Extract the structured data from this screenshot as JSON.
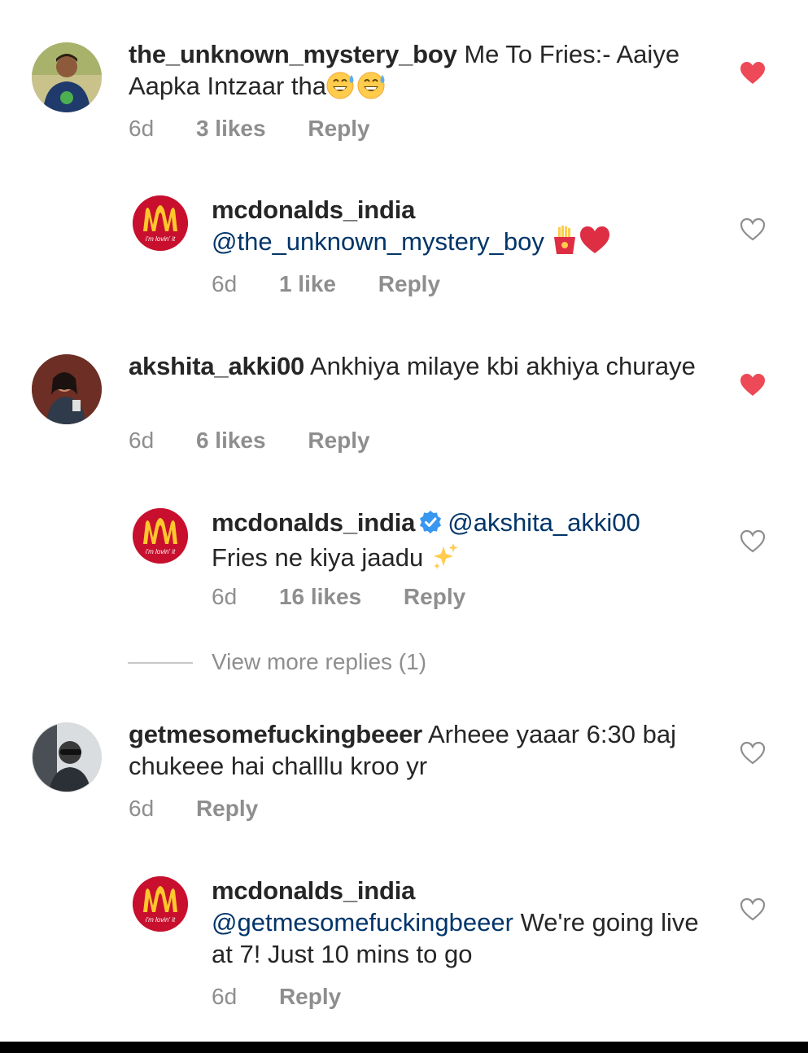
{
  "colors": {
    "liked_heart": "#ed4956",
    "mention": "#003569",
    "meta_text": "#8e8e8e",
    "mcd_red": "#c8102e",
    "mcd_yellow": "#ffc72c",
    "verified_blue": "#3897f0"
  },
  "comments": [
    {
      "username": "the_unknown_mystery_boy",
      "text": "Me To Fries:- Aaiye Aapka Intzaar tha",
      "emojis": [
        "grinning-sweat-emoji",
        "grinning-sweat-emoji"
      ],
      "time": "6d",
      "likes": "3 likes",
      "reply_label": "Reply",
      "liked": true,
      "reply": {
        "username": "mcdonalds_india",
        "mention": "@the_unknown_mystery_boy",
        "text": "",
        "emojis": [
          "fries-emoji",
          "red-heart-emoji"
        ],
        "time": "6d",
        "likes": "1 like",
        "reply_label": "Reply",
        "liked": false,
        "logo_text": "i'm lovin' it"
      }
    },
    {
      "username": "akshita_akki00",
      "text": "Ankhiya milaye kbi akhiya churaye",
      "time": "6d",
      "likes": "6 likes",
      "reply_label": "Reply",
      "liked": true,
      "reply": {
        "username": "mcdonalds_india",
        "verified": true,
        "mention": "@akshita_akki00",
        "text": "Fries ne kiya jaadu",
        "emojis": [
          "sparkles-emoji"
        ],
        "time": "6d",
        "likes": "16 likes",
        "reply_label": "Reply",
        "liked": false,
        "logo_text": "i'm lovin' it"
      },
      "view_more": "View more replies (1)"
    },
    {
      "username": "getmesomefuckingbeeer",
      "text": "Arheee yaaar 6:30 baj chukeee hai challlu kroo yr",
      "time": "6d",
      "reply_label": "Reply",
      "liked": false,
      "reply": {
        "username": "mcdonalds_india",
        "mention": "@getmesomefuckingbeeer",
        "text": "We're going live at 7! Just 10 mins to go",
        "time": "6d",
        "reply_label": "Reply",
        "liked": false,
        "logo_text": "i'm lovin' it"
      }
    }
  ]
}
